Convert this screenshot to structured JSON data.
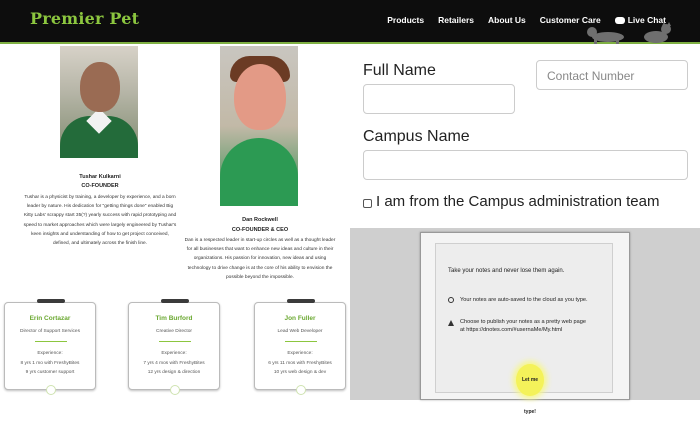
{
  "header": {
    "logo": "Premier Pet",
    "nav": [
      "Products",
      "Retailers",
      "About Us",
      "Customer Care",
      "Live Chat"
    ],
    "accent_color": "#8cc63f"
  },
  "team": {
    "member1": {
      "name": "Tushar Kulkarni",
      "role": "CO-FOUNDER",
      "bio_lines": [
        "Tushar is a physicist by training, a developer by experience, and a born",
        "leader by nature. His dedication for \"getting things done\" enabled Big",
        "Kitty Labs' scrappy start 35(?) yearly success with rapid prototyping and",
        "speed to market approaches which were largely engineered by Tushar's",
        "keen insights and understanding of how to get project conceived,",
        "defined, and ultimately across the finish line."
      ]
    },
    "member2": {
      "name": "Dan Rockwell",
      "role": "CO-FOUNDER & CEO",
      "bio_lines": [
        "Dan is a respected leader in start-up circles as well as a thought leader",
        "for all businesses that want to enhance new ideas and culture in their",
        "organizations. His passion for innovation, new ideas and using",
        "technology to drive change is at the core of his ability to envision the",
        "possible beyond the impossible."
      ]
    },
    "cards": [
      {
        "name": "Erin Cortazar",
        "role": "Director of Support Services",
        "exp_label": "Experience:",
        "line1": "8 yrs 1 mo with FreshyBites",
        "line2": "9 yrs customer support"
      },
      {
        "name": "Tim Burford",
        "role": "Creative Director",
        "exp_label": "Experience:",
        "line1": "7 yrs 4 mos with FreshyBites",
        "line2": "12 yrs design & direction"
      },
      {
        "name": "Jon Fuller",
        "role": "Lead Web Developer",
        "exp_label": "Experience:",
        "line1": "6 yrs 11 mos with FreshyBites",
        "line2": "10 yrs web design & dev"
      }
    ]
  },
  "form": {
    "full_name_label": "Full Name",
    "contact_placeholder": "Contact Number",
    "campus_label": "Campus Name",
    "checkbox_label": "I am from the Campus administration team"
  },
  "doc": {
    "title": "Take your notes and never lose them again.",
    "row1": "Your notes are auto-saved to the cloud as you type.",
    "row2": "Choose to publish your notes as a pretty web page at https://dnotes.com/#usernaMe/My.html",
    "button": "Let me type!"
  }
}
